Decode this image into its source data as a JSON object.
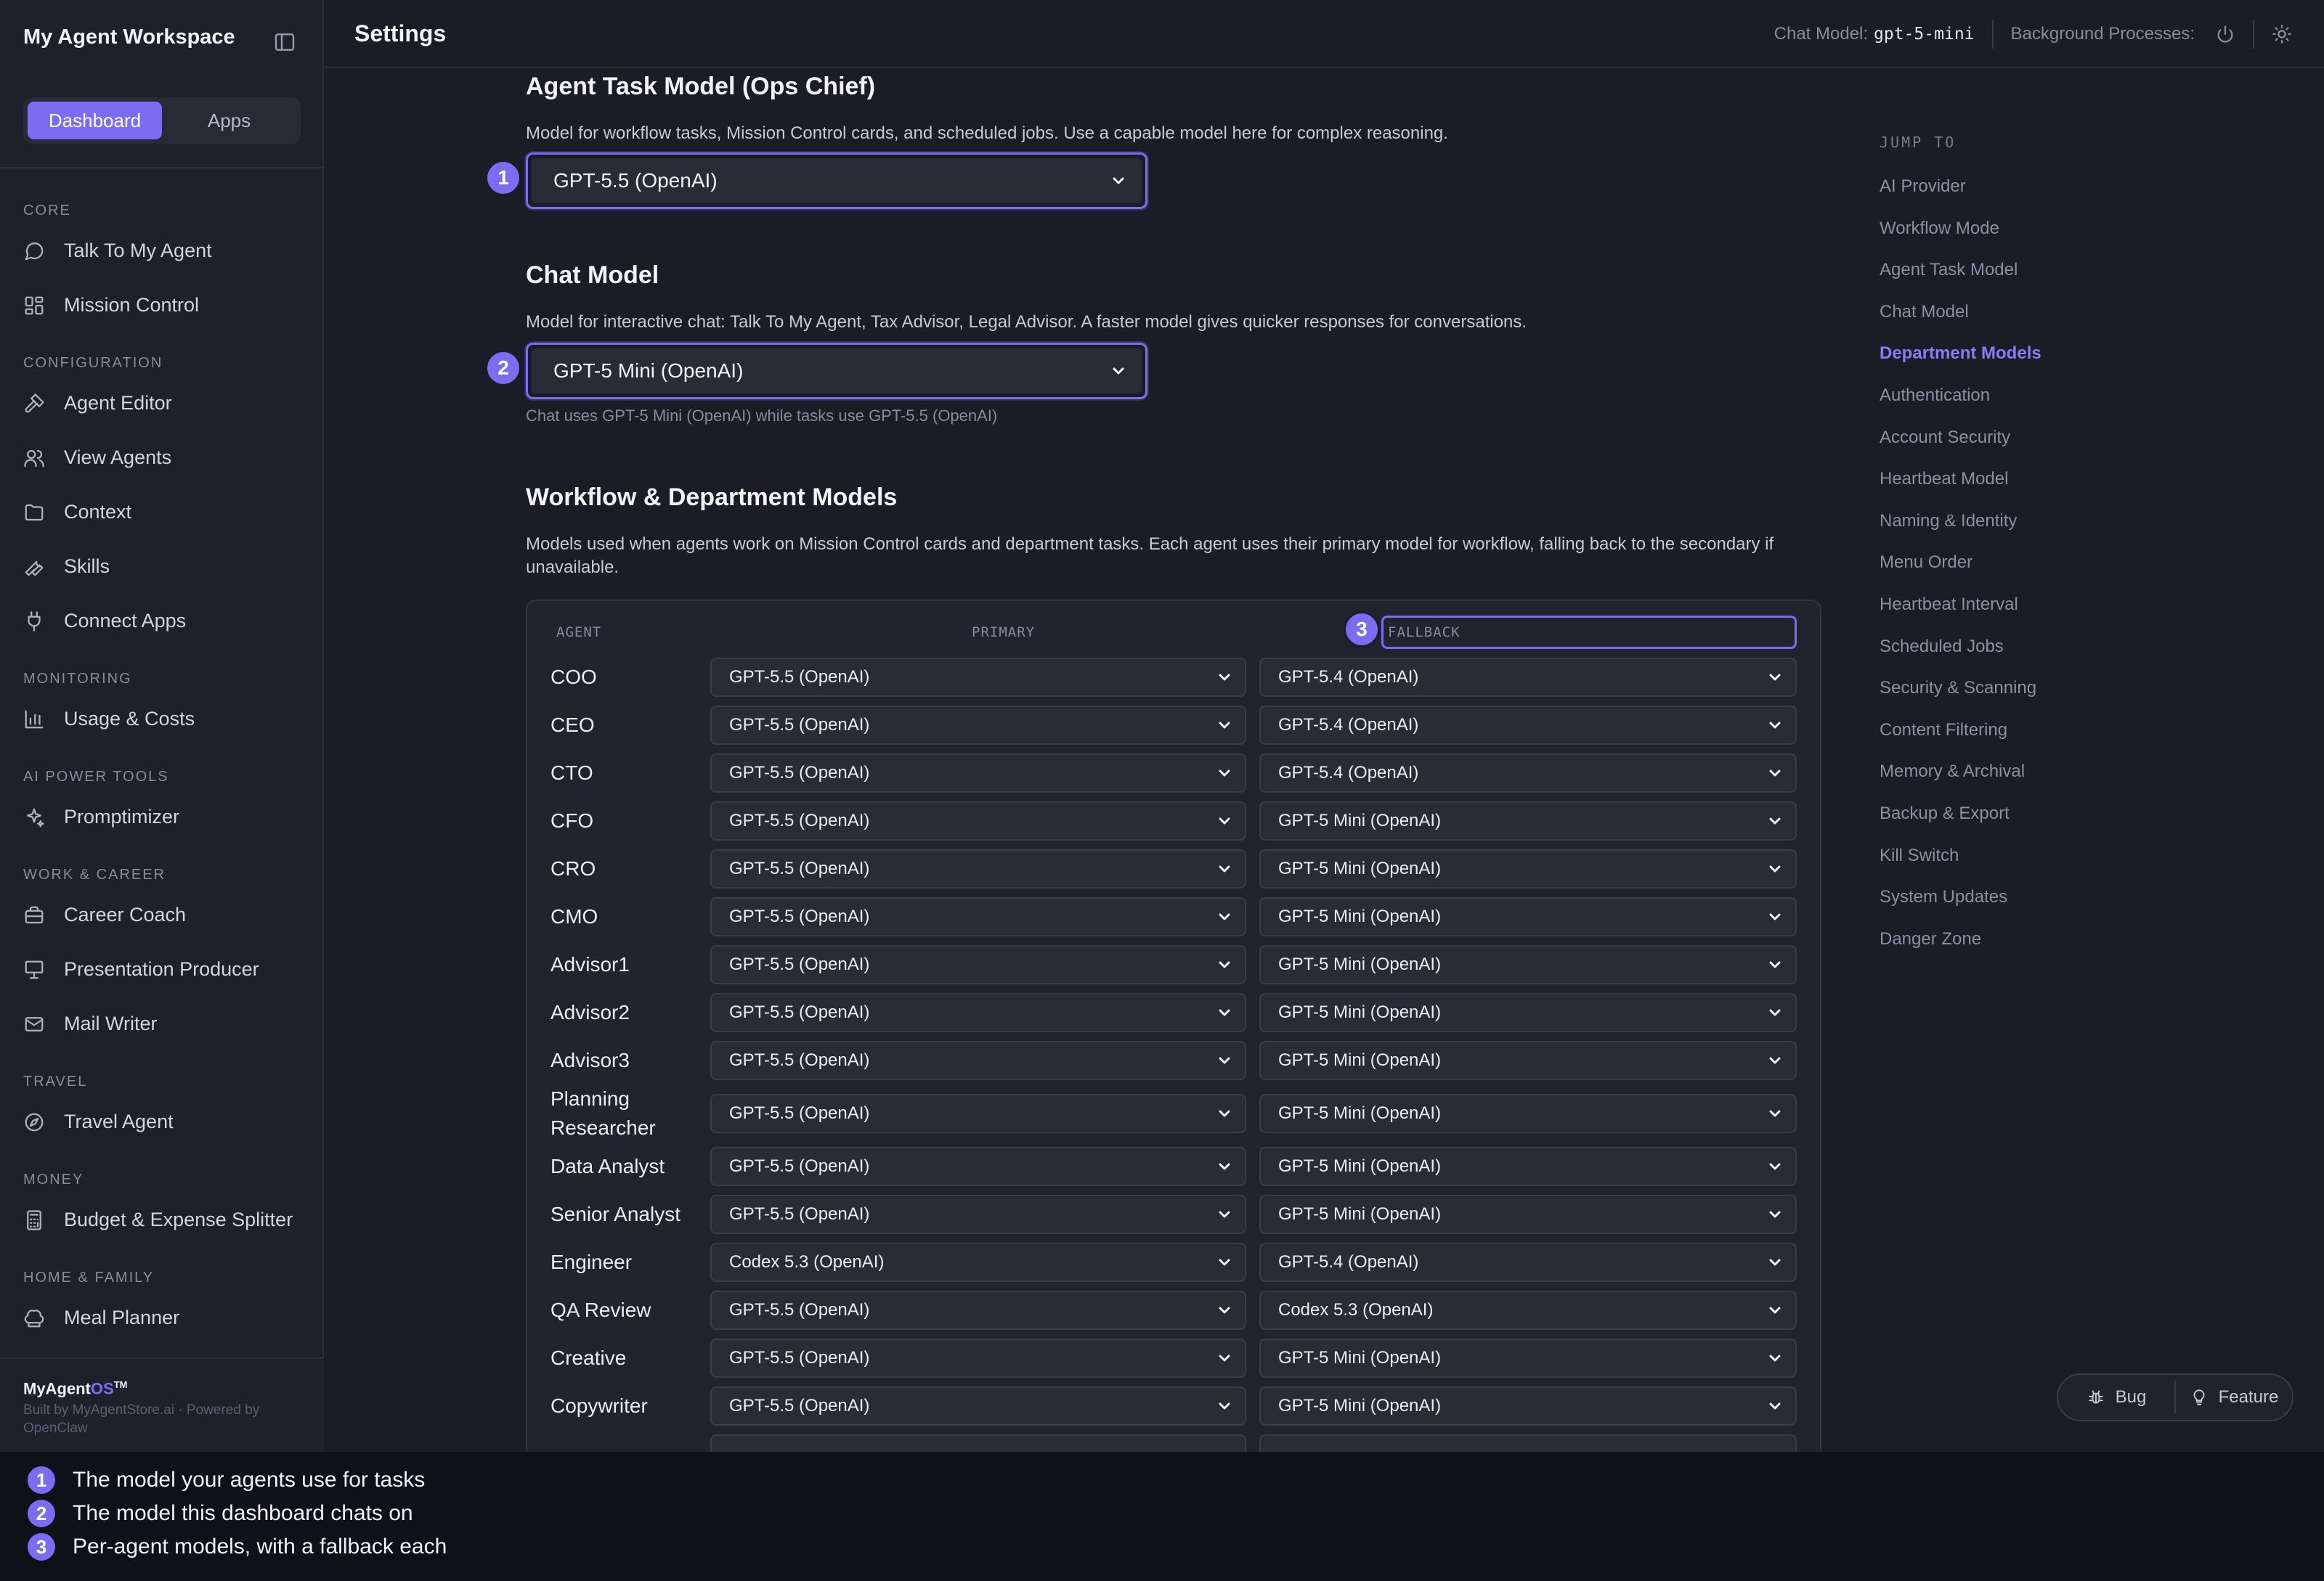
{
  "sidebar": {
    "workspace_title": "My Agent Workspace",
    "tabs": [
      {
        "label": "Dashboard",
        "active": true
      },
      {
        "label": "Apps",
        "active": false
      }
    ],
    "sections": [
      {
        "label": "CORE",
        "items": [
          {
            "label": "Talk To My Agent",
            "icon": "chat-bubble-icon"
          },
          {
            "label": "Mission Control",
            "icon": "grid-icon"
          }
        ]
      },
      {
        "label": "CONFIGURATION",
        "items": [
          {
            "label": "Agent Editor",
            "icon": "hammer-icon"
          },
          {
            "label": "View Agents",
            "icon": "users-icon"
          },
          {
            "label": "Context",
            "icon": "folder-icon"
          },
          {
            "label": "Skills",
            "icon": "wrench-icon"
          },
          {
            "label": "Connect Apps",
            "icon": "plug-icon"
          }
        ]
      },
      {
        "label": "MONITORING",
        "items": [
          {
            "label": "Usage & Costs",
            "icon": "bar-chart-icon"
          }
        ]
      },
      {
        "label": "AI POWER TOOLS",
        "items": [
          {
            "label": "Promptimizer",
            "icon": "sparkles-icon"
          }
        ]
      },
      {
        "label": "WORK & CAREER",
        "items": [
          {
            "label": "Career Coach",
            "icon": "briefcase-icon"
          },
          {
            "label": "Presentation Producer",
            "icon": "presentation-icon"
          },
          {
            "label": "Mail Writer",
            "icon": "mail-icon"
          }
        ]
      },
      {
        "label": "TRAVEL",
        "items": [
          {
            "label": "Travel Agent",
            "icon": "compass-icon"
          }
        ]
      },
      {
        "label": "MONEY",
        "items": [
          {
            "label": "Budget & Expense Splitter",
            "icon": "calculator-icon"
          }
        ]
      },
      {
        "label": "HOME & FAMILY",
        "items": [
          {
            "label": "Meal Planner",
            "icon": "chef-hat-icon"
          }
        ]
      }
    ],
    "footer": {
      "brand_prefix": "MyAgent",
      "brand_suffix": "OS",
      "brand_mark": "TM",
      "credits": "Built by MyAgentStore.ai · Powered by OpenClaw"
    }
  },
  "header": {
    "title": "Settings",
    "chat_model_label": "Chat Model:",
    "chat_model_value": "gpt-5-mini",
    "background_label": "Background Processes:"
  },
  "agent_task": {
    "heading": "Agent Task Model (Ops Chief)",
    "description": "Model for workflow tasks, Mission Control cards, and scheduled jobs. Use a capable model here for complex reasoning.",
    "selected": "GPT-5.5 (OpenAI)",
    "badge": "1"
  },
  "chat_model": {
    "heading": "Chat Model",
    "description": "Model for interactive chat: Talk To My Agent, Tax Advisor, Legal Advisor. A faster model gives quicker responses for conversations.",
    "selected": "GPT-5 Mini (OpenAI)",
    "hint": "Chat uses GPT-5 Mini (OpenAI) while tasks use GPT-5.5 (OpenAI)",
    "badge": "2"
  },
  "workflow": {
    "heading": "Workflow & Department Models",
    "description": "Models used when agents work on Mission Control cards and department tasks. Each agent uses their primary model for workflow, falling back to the secondary if unavailable.",
    "badge": "3",
    "columns": {
      "agent": "AGENT",
      "primary": "PRIMARY",
      "fallback": "FALLBACK"
    },
    "rows": [
      {
        "agent": "COO",
        "primary": "GPT-5.5 (OpenAI)",
        "fallback": "GPT-5.4 (OpenAI)"
      },
      {
        "agent": "CEO",
        "primary": "GPT-5.5 (OpenAI)",
        "fallback": "GPT-5.4 (OpenAI)"
      },
      {
        "agent": "CTO",
        "primary": "GPT-5.5 (OpenAI)",
        "fallback": "GPT-5.4 (OpenAI)"
      },
      {
        "agent": "CFO",
        "primary": "GPT-5.5 (OpenAI)",
        "fallback": "GPT-5 Mini (OpenAI)"
      },
      {
        "agent": "CRO",
        "primary": "GPT-5.5 (OpenAI)",
        "fallback": "GPT-5 Mini (OpenAI)"
      },
      {
        "agent": "CMO",
        "primary": "GPT-5.5 (OpenAI)",
        "fallback": "GPT-5 Mini (OpenAI)"
      },
      {
        "agent": "Advisor1",
        "primary": "GPT-5.5 (OpenAI)",
        "fallback": "GPT-5 Mini (OpenAI)"
      },
      {
        "agent": "Advisor2",
        "primary": "GPT-5.5 (OpenAI)",
        "fallback": "GPT-5 Mini (OpenAI)"
      },
      {
        "agent": "Advisor3",
        "primary": "GPT-5.5 (OpenAI)",
        "fallback": "GPT-5 Mini (OpenAI)"
      },
      {
        "agent": "Planning Researcher",
        "primary": "GPT-5.5 (OpenAI)",
        "fallback": "GPT-5 Mini (OpenAI)"
      },
      {
        "agent": "Data Analyst",
        "primary": "GPT-5.5 (OpenAI)",
        "fallback": "GPT-5 Mini (OpenAI)"
      },
      {
        "agent": "Senior Analyst",
        "primary": "GPT-5.5 (OpenAI)",
        "fallback": "GPT-5 Mini (OpenAI)"
      },
      {
        "agent": "Engineer",
        "primary": "Codex 5.3 (OpenAI)",
        "fallback": "GPT-5.4 (OpenAI)"
      },
      {
        "agent": "QA Review",
        "primary": "GPT-5.5 (OpenAI)",
        "fallback": "Codex 5.3 (OpenAI)"
      },
      {
        "agent": "Creative",
        "primary": "GPT-5.5 (OpenAI)",
        "fallback": "GPT-5 Mini (OpenAI)"
      },
      {
        "agent": "Copywriter",
        "primary": "GPT-5.5 (OpenAI)",
        "fallback": "GPT-5 Mini (OpenAI)"
      }
    ]
  },
  "jump_to": {
    "label": "JUMP TO",
    "items": [
      {
        "label": "AI Provider",
        "active": false
      },
      {
        "label": "Workflow Mode",
        "active": false
      },
      {
        "label": "Agent Task Model",
        "active": false
      },
      {
        "label": "Chat Model",
        "active": false
      },
      {
        "label": "Department Models",
        "active": true
      },
      {
        "label": "Authentication",
        "active": false
      },
      {
        "label": "Account Security",
        "active": false
      },
      {
        "label": "Heartbeat Model",
        "active": false
      },
      {
        "label": "Naming & Identity",
        "active": false
      },
      {
        "label": "Menu Order",
        "active": false
      },
      {
        "label": "Heartbeat Interval",
        "active": false
      },
      {
        "label": "Scheduled Jobs",
        "active": false
      },
      {
        "label": "Security & Scanning",
        "active": false
      },
      {
        "label": "Content Filtering",
        "active": false
      },
      {
        "label": "Memory & Archival",
        "active": false
      },
      {
        "label": "Backup & Export",
        "active": false
      },
      {
        "label": "Kill Switch",
        "active": false
      },
      {
        "label": "System Updates",
        "active": false
      },
      {
        "label": "Danger Zone",
        "active": false
      }
    ]
  },
  "feedback": {
    "bug_label": "Bug",
    "feature_label": "Feature"
  },
  "legend": [
    {
      "num": "1",
      "text": "The model your agents use for tasks"
    },
    {
      "num": "2",
      "text": "The model this dashboard chats on"
    },
    {
      "num": "3",
      "text": "Per-agent models, with a fallback each"
    }
  ],
  "colors": {
    "accent": "#7b6cf2",
    "background": "#1c1c26",
    "sidebar": "#20202b"
  }
}
